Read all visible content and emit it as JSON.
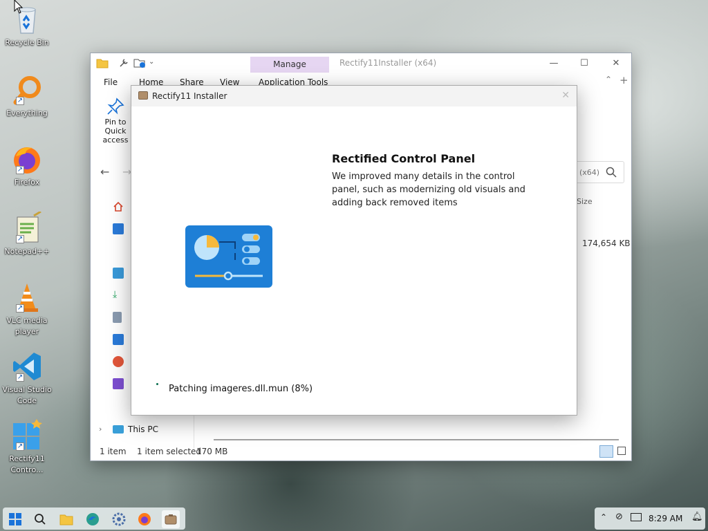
{
  "desktop": {
    "icons": [
      {
        "label": "Recycle Bin"
      },
      {
        "label": "Everything"
      },
      {
        "label": "Firefox"
      },
      {
        "label": "Notepad++"
      },
      {
        "label": "VLC media player"
      },
      {
        "label": "Visual Studio Code"
      },
      {
        "label": "Rectify11 Contro..."
      }
    ]
  },
  "explorer": {
    "manage_tab": "Manage",
    "title": "Rectify11Installer (x64)",
    "menu": {
      "file": "File",
      "home": "Home",
      "share": "Share",
      "view": "View",
      "application_tools": "Application Tools"
    },
    "ribbon": {
      "pin_label": "Pin to Quick access"
    },
    "search_text": "(x64)",
    "nav_pane": {
      "this_pc": "This PC"
    },
    "column_header_size": "Size",
    "file_size": "174,654 KB",
    "status": {
      "item_count": "1 item",
      "selected": "1 item selected",
      "selected_size": "170 MB"
    }
  },
  "installer": {
    "title": "Rectify11 Installer",
    "feature_title": "Rectified Control Panel",
    "feature_description": "We improved many details in the control panel, such as modernizing old visuals and adding back removed items",
    "progress_text": "Patching imageres.dll.mun (8%)"
  },
  "taskbar": {
    "clock": "8:29 AM"
  },
  "colors": {
    "manage_tab_bg": "#e6d6f2",
    "cp_icon_blue": "#1e7fd6",
    "cp_icon_yellow": "#f6b93b",
    "progress_dot": "#0a6e4f"
  }
}
